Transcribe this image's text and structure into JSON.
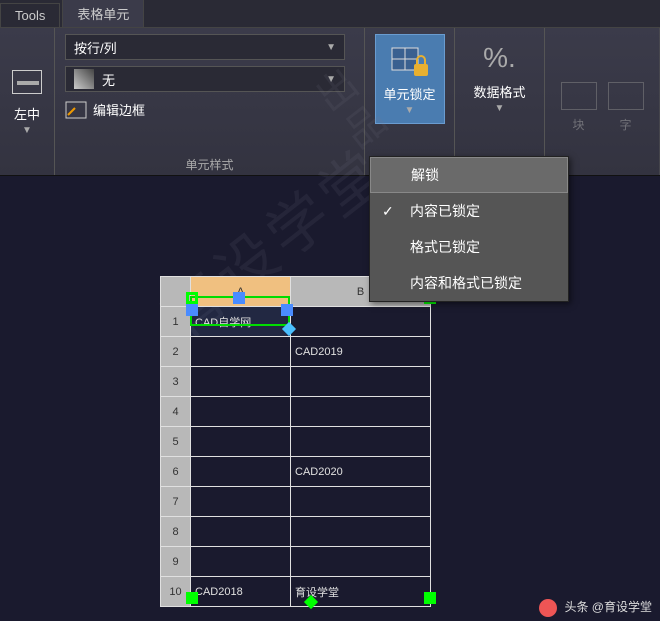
{
  "tabs": {
    "tools": "Tools",
    "table_cell": "表格单元"
  },
  "align": {
    "label": "左中"
  },
  "style": {
    "row_col": "按行/列",
    "none": "无",
    "edit_border": "编辑边框",
    "panel_label": "单元样式"
  },
  "lock": {
    "button": "单元锁定",
    "menu": {
      "unlock": "解锁",
      "content_locked": "内容已锁定",
      "format_locked": "格式已锁定",
      "both_locked": "内容和格式已锁定"
    }
  },
  "fmt": {
    "label": "数据格式",
    "sym": "%."
  },
  "other": {
    "block": "块",
    "field": "字"
  },
  "watermark": "育设学堂",
  "watermark2": "出品",
  "table": {
    "cols": [
      "A",
      "B"
    ],
    "rows": [
      {
        "n": "1",
        "a": "CAD自学网",
        "b": ""
      },
      {
        "n": "2",
        "a": "",
        "b": "CAD2019"
      },
      {
        "n": "3",
        "a": "",
        "b": ""
      },
      {
        "n": "4",
        "a": "",
        "b": ""
      },
      {
        "n": "5",
        "a": "",
        "b": ""
      },
      {
        "n": "6",
        "a": "",
        "b": "CAD2020"
      },
      {
        "n": "7",
        "a": "",
        "b": ""
      },
      {
        "n": "8",
        "a": "",
        "b": ""
      },
      {
        "n": "9",
        "a": "",
        "b": ""
      },
      {
        "n": "10",
        "a": "CAD2018",
        "b": "育设学堂"
      }
    ]
  },
  "credit": {
    "prefix": "头条 @",
    "name": "育设学堂"
  }
}
